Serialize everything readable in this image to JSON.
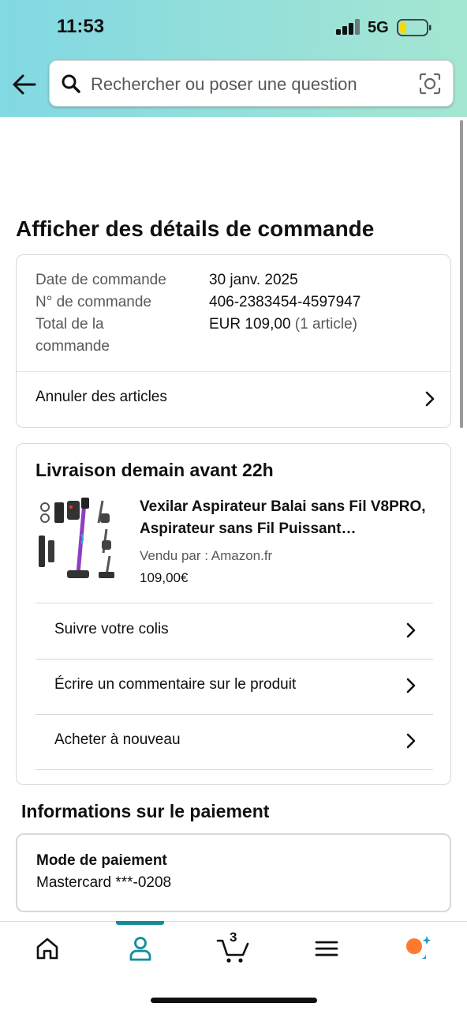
{
  "status_bar": {
    "time": "11:53",
    "network": "5G"
  },
  "search": {
    "placeholder": "Rechercher ou poser une question"
  },
  "page_title": "Afficher des détails de commande",
  "order_summary": {
    "date_label": "Date de commande",
    "date_value": "30 janv. 2025",
    "number_label": "N° de commande",
    "number_value": "406-2383454-4597947",
    "total_label_line1": "Total de la",
    "total_label_line2": "commande",
    "total_value": "EUR 109,00",
    "total_count": "(1 article)",
    "cancel_label": "Annuler des articles"
  },
  "shipment": {
    "title": "Livraison demain avant 22h",
    "product_name": "Vexilar Aspirateur Balai sans Fil V8PRO, Aspirateur sans Fil Puissant…",
    "seller": "Vendu par  : Amazon.fr",
    "price": "109,00€",
    "actions": {
      "track": "Suivre votre colis",
      "review": "Écrire un commentaire sur le produit",
      "buy_again": "Acheter à nouveau"
    }
  },
  "payment": {
    "section_title": "Informations sur le paiement",
    "method_label": "Mode de paiement",
    "method_value": "Mastercard ***-0208"
  },
  "bottom_nav": {
    "cart_count": "3",
    "items": [
      "home-icon",
      "account-icon",
      "cart-icon",
      "menu-icon",
      "rufus-icon"
    ],
    "active": "account-icon"
  },
  "colors": {
    "header_gradient_start": "#82d8e3",
    "header_gradient_end": "#a5e6d2",
    "accent": "#138d9a",
    "battery": "#f5d90a",
    "rufus_orange": "#ff7a2f",
    "rufus_blue": "#1aa0c2"
  }
}
